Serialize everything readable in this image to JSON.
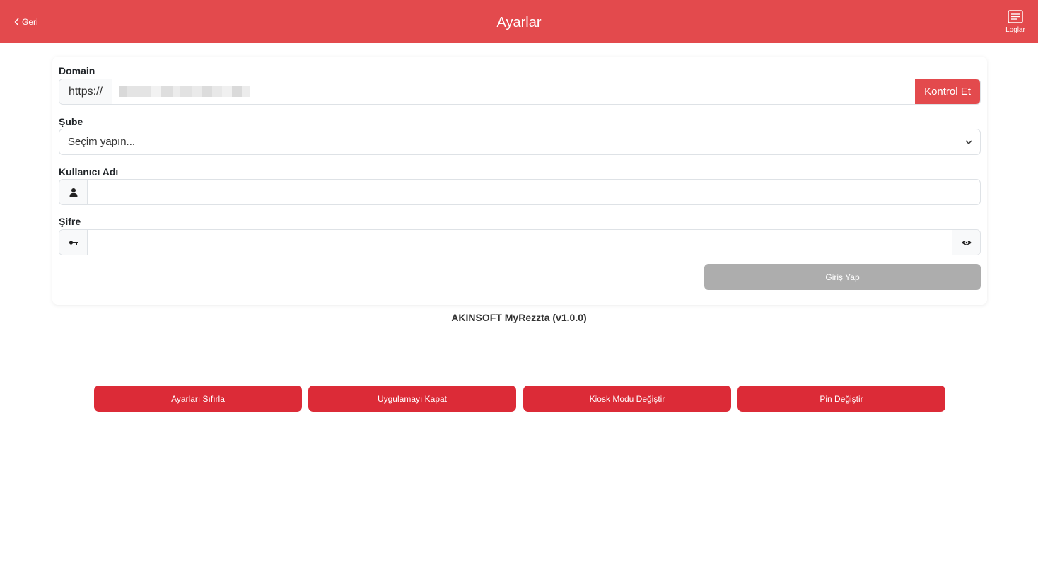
{
  "header": {
    "back_label": "Geri",
    "title": "Ayarlar",
    "logs_label": "Loglar"
  },
  "form": {
    "domain": {
      "label": "Domain",
      "prefix": "https://",
      "value": "",
      "check_label": "Kontrol Et"
    },
    "branch": {
      "label": "Şube",
      "selected": "Seçim yapın..."
    },
    "username": {
      "label": "Kullanıcı Adı",
      "value": ""
    },
    "password": {
      "label": "Şifre",
      "value": ""
    },
    "login_label": "Giriş Yap"
  },
  "version_text": "AKINSOFT MyRezzta (v1.0.0)",
  "actions": [
    {
      "label": "Ayarları Sıfırla"
    },
    {
      "label": "Uygulamayı Kapat"
    },
    {
      "label": "Kiosk Modu Değiştir"
    },
    {
      "label": "Pin Değiştir"
    }
  ],
  "colors": {
    "header": "#e34a4d",
    "action": "#dc2b37",
    "disabled": "#adadad"
  },
  "icons": {
    "back": "chevron-left-icon",
    "logs": "list-icon",
    "user": "user-icon",
    "key": "key-icon",
    "eye": "eye-icon",
    "select": "chevron-down-icon"
  }
}
